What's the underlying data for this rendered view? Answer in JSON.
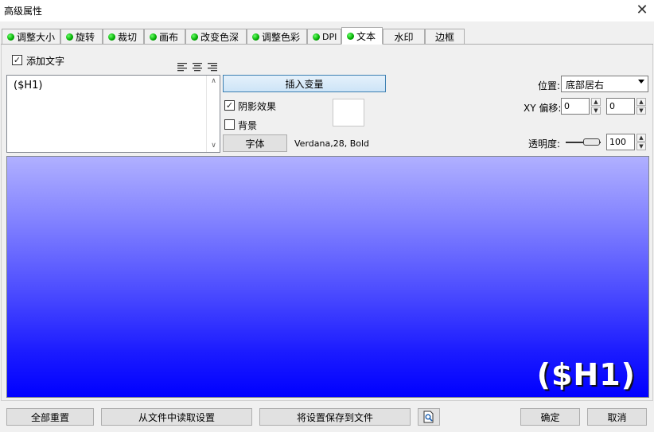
{
  "window": {
    "title": "高级属性"
  },
  "tabs": [
    {
      "label": "调整大小",
      "icon": "green-dot-icon"
    },
    {
      "label": "旋转",
      "icon": "green-dot-icon"
    },
    {
      "label": "裁切",
      "icon": "green-dot-icon"
    },
    {
      "label": "画布",
      "icon": "green-dot-icon"
    },
    {
      "label": "改变色深",
      "icon": "green-dot-icon"
    },
    {
      "label": "调整色彩",
      "icon": "green-dot-icon"
    },
    {
      "label": "DPI",
      "icon": "green-dot-icon"
    },
    {
      "label": "文本",
      "icon": "green-dot-icon",
      "active": true
    },
    {
      "label": "水印"
    },
    {
      "label": "边框"
    }
  ],
  "text_tab": {
    "add_text_label": "添加文字",
    "add_text_checked": true,
    "align_icons": [
      "align-left-icon",
      "align-center-icon",
      "align-right-icon"
    ],
    "text_value": "($H1)",
    "insert_variable_label": "插入变量",
    "shadow_label": "阴影效果",
    "shadow_checked": true,
    "background_label": "背景",
    "background_checked": false,
    "font_button_label": "字体",
    "font_info": "Verdana,28, Bold",
    "position_label": "位置:",
    "position_value": "底部居右",
    "offset_label": "XY 偏移:",
    "offset_x": "0",
    "offset_y": "0",
    "opacity_label": "透明度:",
    "opacity_value": "100"
  },
  "preview": {
    "text": "($H1)"
  },
  "buttons": {
    "reset_all": "全部重置",
    "load_from_file": "从文件中读取设置",
    "save_to_file": "将设置保存到文件",
    "ok": "确定",
    "cancel": "取消"
  }
}
